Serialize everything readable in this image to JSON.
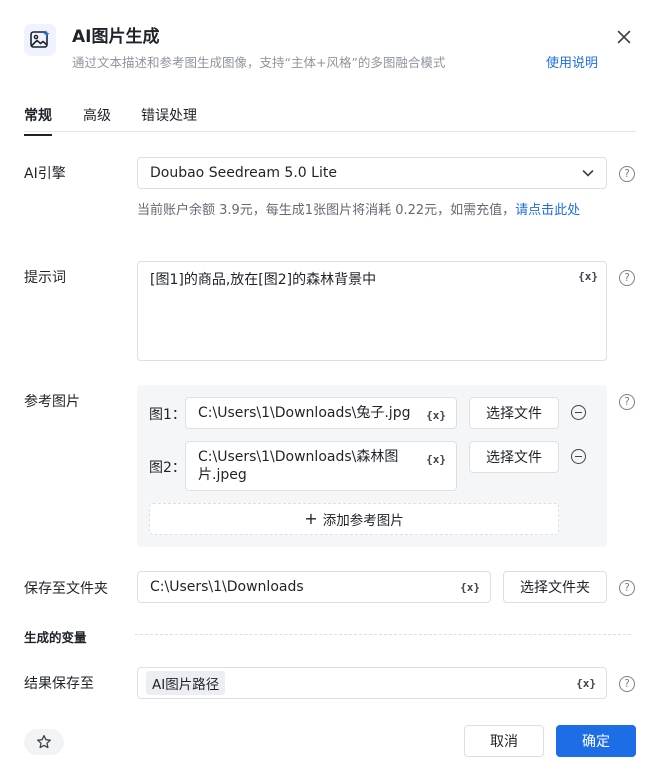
{
  "header": {
    "title": "AI图片生成",
    "subtitle": "通过文本描述和参考图生成图像，支持“主体+风格”的多图融合模式",
    "help_link": "使用说明"
  },
  "tabs": [
    {
      "label": "常规",
      "active": true
    },
    {
      "label": "高级",
      "active": false
    },
    {
      "label": "错误处理",
      "active": false
    }
  ],
  "engine": {
    "label": "AI引擎",
    "value": "Doubao Seedream 5.0 Lite",
    "balance_text": "当前账户余额 3.9元，每生成1张图片将消耗 0.22元，如需充值，",
    "recharge_link": "请点击此处"
  },
  "prompt": {
    "label": "提示词",
    "value": "[图1]的商品,放在[图2]的森林背景中"
  },
  "reference": {
    "label": "参考图片",
    "images": [
      {
        "label": "图1：",
        "path": "C:\\Users\\1\\Downloads\\兔子.jpg",
        "button": "选择文件"
      },
      {
        "label": "图2：",
        "path": "C:\\Users\\1\\Downloads\\森林图片.jpeg",
        "button": "选择文件"
      }
    ],
    "add_button": "添加参考图片"
  },
  "save_folder": {
    "label": "保存至文件夹",
    "value": "C:\\Users\\1\\Downloads",
    "button": "选择文件夹"
  },
  "variables": {
    "section_title": "生成的变量",
    "result_label": "结果保存至",
    "result_tag": "AI图片路径"
  },
  "icons": {
    "variable": "{x}",
    "help": "?",
    "add": "+"
  },
  "footer": {
    "cancel": "取消",
    "confirm": "确定"
  },
  "colors": {
    "accent": "#1d6ee6",
    "text": "#1f2329",
    "muted": "#8f959e"
  }
}
